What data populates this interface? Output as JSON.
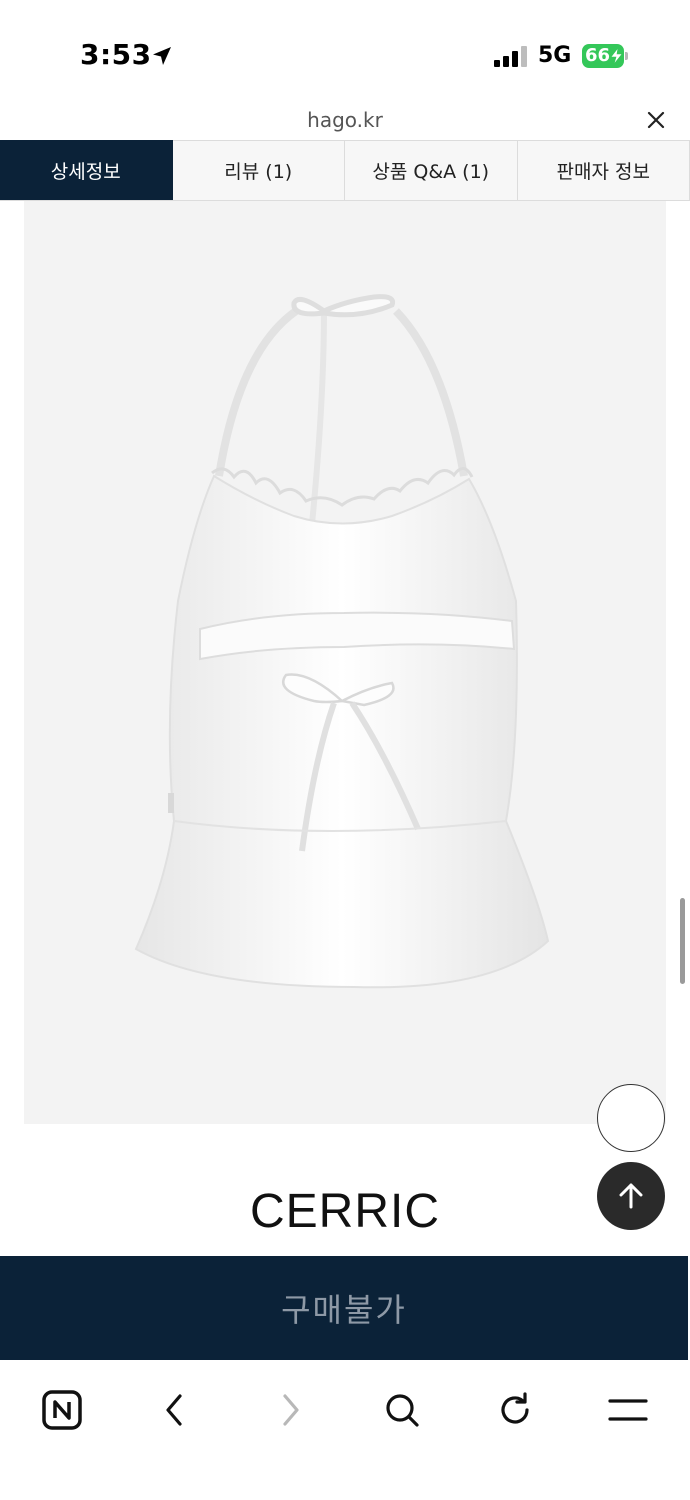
{
  "status_bar": {
    "time": "3:53",
    "network": "5G",
    "battery": "66",
    "icons": [
      "location-arrow-icon",
      "signal-bars-icon",
      "battery-charging-icon"
    ]
  },
  "browser": {
    "url": "hago.kr",
    "close_icon": "close-icon"
  },
  "tabs": [
    {
      "label": "상세정보",
      "active": true
    },
    {
      "label": "리뷰 (1)",
      "active": false
    },
    {
      "label": "상품 Q&A (1)",
      "active": false
    },
    {
      "label": "판매자 정보",
      "active": false
    }
  ],
  "product": {
    "brand": "CERRIC",
    "image_icon": "white-halter-top-image"
  },
  "floating_buttons": {
    "empty_icon": "circle-button-icon",
    "top_icon": "arrow-up-icon"
  },
  "purchase": {
    "label": "구매불가"
  },
  "bottom_nav": {
    "items": [
      "naver-icon",
      "back-icon",
      "forward-icon",
      "search-icon",
      "refresh-icon",
      "menu-icon"
    ]
  },
  "colors": {
    "navy": "#0b2238",
    "battery_green": "#34c759",
    "image_bg": "#f3f3f3"
  }
}
